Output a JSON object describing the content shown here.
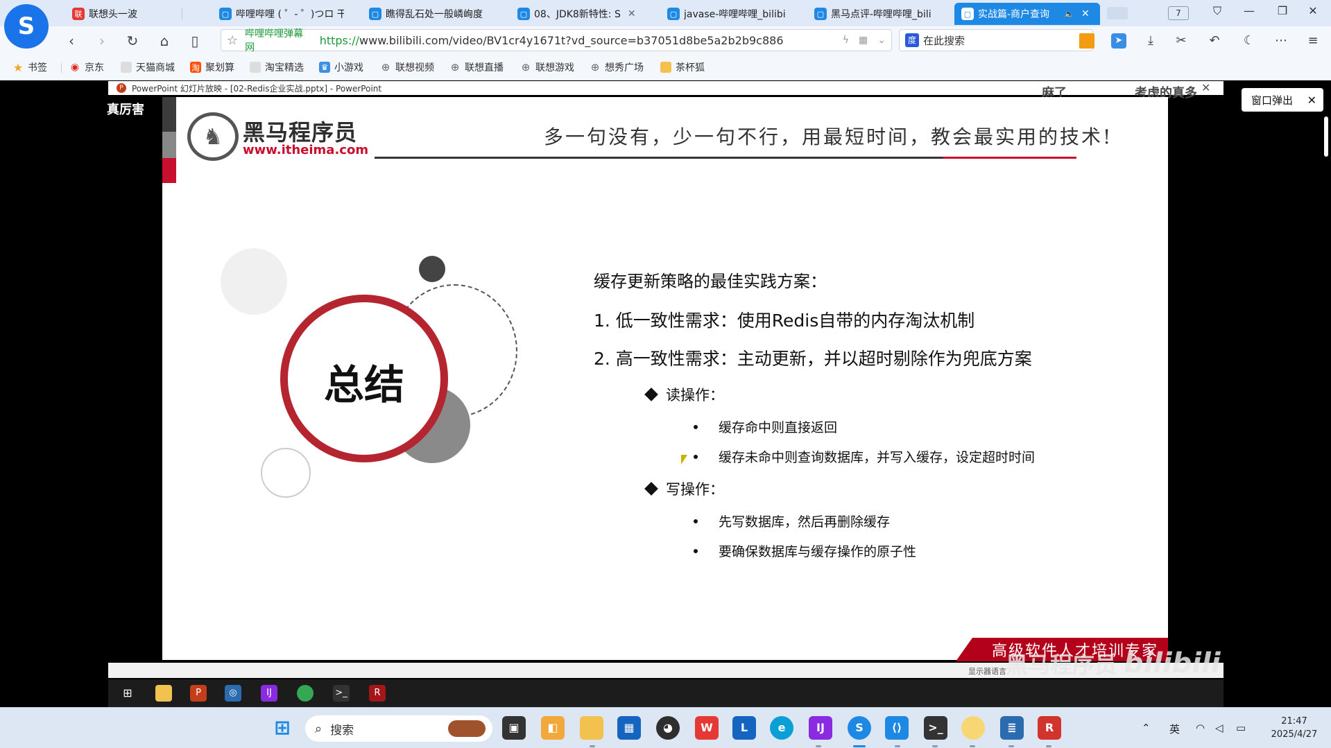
{
  "browser": {
    "tabs": [
      {
        "label": "联想头一波",
        "icon_color": "#e53935",
        "active": false
      },
      {
        "label": "哔哩哔哩 ( ゜- ゜)つロ 干",
        "icon_color": "#1e88e5",
        "active": false
      },
      {
        "label": "瞧得乱石处一般嶙峋度",
        "icon_color": "#1e88e5",
        "active": false
      },
      {
        "label": "08、JDK8新特性: S",
        "icon_color": "#1e88e5",
        "active": false
      },
      {
        "label": "javase-哔哩哔哩_bilibi",
        "icon_color": "#1e88e5",
        "active": false
      },
      {
        "label": "黑马点评-哔哩哔哩_bili",
        "icon_color": "#1e88e5",
        "active": false
      },
      {
        "label": "实战篇-商户查询",
        "icon_color": "#ffffff",
        "active": true
      }
    ],
    "tab_count": "7",
    "address": {
      "site_name": "哔哩哔哩弹幕网",
      "scheme": "https://",
      "url": "www.bilibili.com/video/BV1cr4y1671t?vd_source=b37051d8be5a2b2b9c886"
    },
    "search_placeholder": "在此搜索",
    "bookmarks": [
      {
        "label": "书签",
        "icon": "star-icon",
        "color": "#f5a623"
      },
      {
        "label": "京东",
        "icon": "jd-icon",
        "color": "#e1251b"
      },
      {
        "label": "天猫商城",
        "icon": "tmall-icon",
        "color": "#aaaaaa"
      },
      {
        "label": "聚划算",
        "icon": "juhuasuan-icon",
        "color": "#ff4f00"
      },
      {
        "label": "淘宝精选",
        "icon": "taobao-icon",
        "color": "#aaaaaa"
      },
      {
        "label": "小游戏",
        "icon": "game-icon",
        "color": "#3a8ee6"
      },
      {
        "label": "联想视频",
        "icon": "globe-icon",
        "color": "#666666"
      },
      {
        "label": "联想直播",
        "icon": "globe-icon",
        "color": "#666666"
      },
      {
        "label": "联想游戏",
        "icon": "globe-icon",
        "color": "#666666"
      },
      {
        "label": "想秀广场",
        "icon": "globe-icon",
        "color": "#666666"
      },
      {
        "label": "茶杯狐",
        "icon": "folder-icon",
        "color": "#f2c14e"
      }
    ]
  },
  "player": {
    "ppt_title": "PowerPoint 幻灯片放映 - [02-Redis企业实战.pptx] - PowerPoint",
    "danmu": [
      "真厉害",
      "麻了",
      "考虑的真多"
    ],
    "popout_label": "窗口弹出"
  },
  "slide": {
    "logo_cn": "黑马程序员",
    "logo_en": "www.itheima.com",
    "slogan": "多一句没有，少一句不行，用最短时间，教会最实用的技术!",
    "ring_title": "总结",
    "heading": "缓存更新策略的最佳实践方案：",
    "items": [
      "1.  低一致性需求：使用Redis自带的内存淘汰机制",
      "2.  高一致性需求：主动更新，并以超时剔除作为兜底方案"
    ],
    "read_label": "读操作：",
    "read_bullets": [
      "缓存命中则直接返回",
      "缓存未命中则查询数据库，并写入缓存，设定超时时间"
    ],
    "write_label": "写操作：",
    "write_bullets": [
      "先写数据库，然后再删除缓存",
      "要确保数据库与缓存操作的原子性"
    ],
    "badge": "高级软件人才培训专家",
    "notes_label": "显示器语言",
    "watermark": "黑马程序员",
    "bili_watermark": "bilibili"
  },
  "taskbar": {
    "search_placeholder": "搜索",
    "tray_lang": "英",
    "time": "21:47",
    "date": "2025/4/27"
  },
  "colors": {
    "accent_red": "#c8102e",
    "browser_blue": "#1e88e5",
    "taskbar_bg": "#dde7f3"
  }
}
